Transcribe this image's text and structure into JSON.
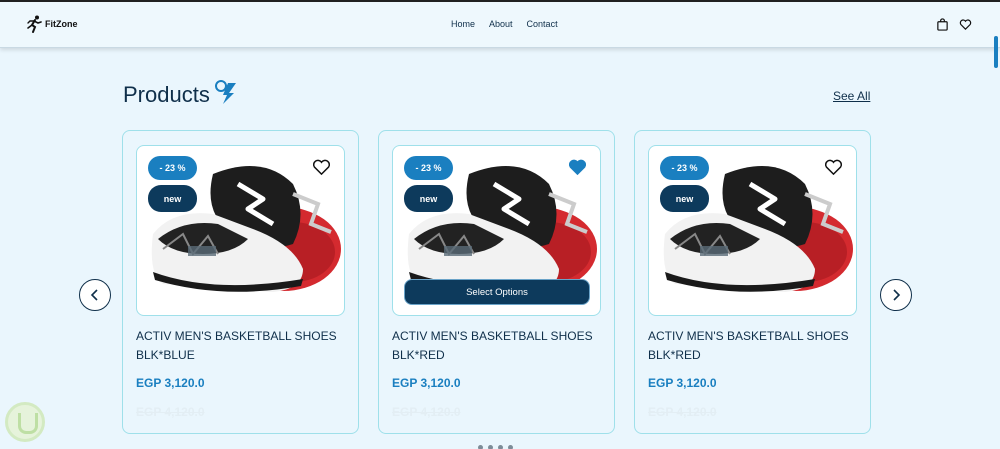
{
  "brand": {
    "name": "FitZone",
    "logo_icon": "runner-icon"
  },
  "nav": {
    "links": [
      "Home",
      "About",
      "Contact"
    ],
    "icons": [
      "shopping-bag-icon",
      "heart-icon"
    ]
  },
  "section": {
    "title": "Products",
    "title_icon": "lightning-icon",
    "see_all": "See All"
  },
  "products": [
    {
      "discount": "- 23 %",
      "tag": "new",
      "title": "ACTIV MEN'S BASKETBALL SHOES BLK*BLUE",
      "price": "EGP 3,120.0",
      "old_price": "EGP 4,120.0",
      "favorited": false,
      "show_select": false
    },
    {
      "discount": "- 23 %",
      "tag": "new",
      "title": "ACTIV MEN'S BASKETBALL SHOES BLK*RED",
      "price": "EGP 3,120.0",
      "old_price": "EGP 4,120.0",
      "favorited": true,
      "show_select": true,
      "select_label": "Select Options"
    },
    {
      "discount": "- 23 %",
      "tag": "new",
      "title": "ACTIV MEN'S BASKETBALL SHOES BLK*RED",
      "price": "EGP 3,120.0",
      "old_price": "EGP 4,120.0",
      "favorited": false,
      "show_select": false
    }
  ],
  "carousel": {
    "prev_icon": "chevron-left-icon",
    "next_icon": "chevron-right-icon",
    "dots": 4
  },
  "colors": {
    "background": "#eaf6fd",
    "primary": "#1a7fc0",
    "dark": "#0d3a5c",
    "text": "#0f2f4a"
  }
}
